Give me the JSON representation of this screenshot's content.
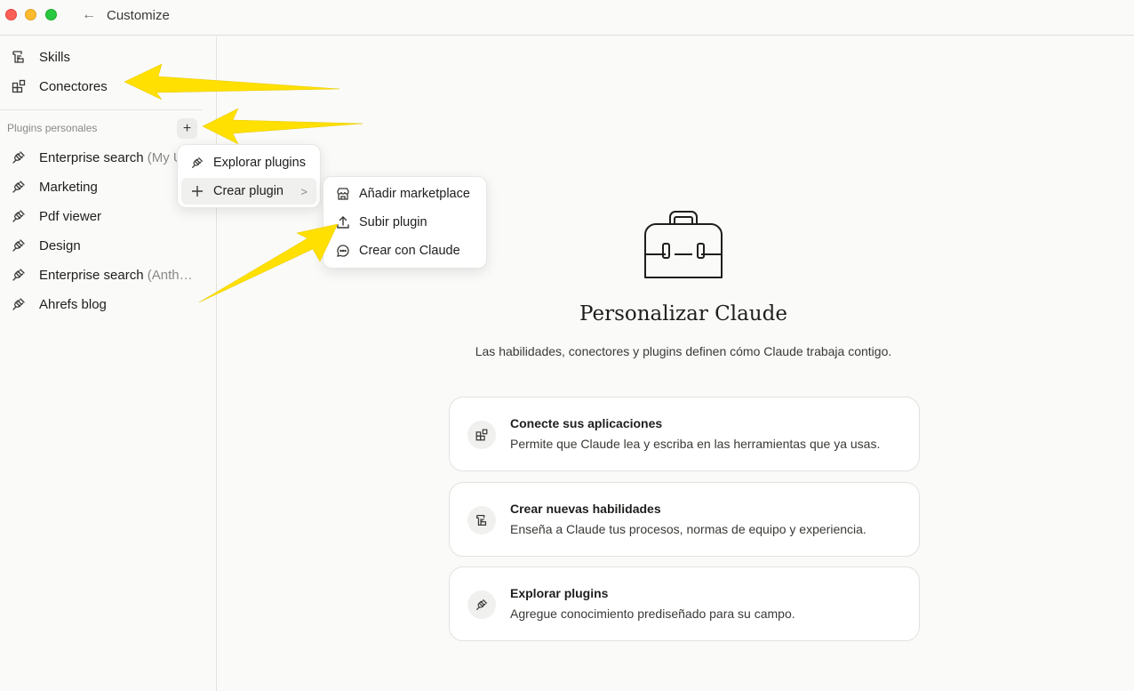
{
  "window": {
    "title": "Customize",
    "back_icon": "arrow-left-icon"
  },
  "sidebar": {
    "nav": [
      {
        "label": "Skills",
        "icon": "skills-icon"
      },
      {
        "label": "Conectores",
        "icon": "connectors-icon"
      }
    ],
    "section_label": "Plugins personales",
    "add_button": "+",
    "plugins": [
      {
        "label": "Enterprise search",
        "suffix": " (My U",
        "icon": "plug-icon"
      },
      {
        "label": "Marketing",
        "suffix": "",
        "icon": "plug-icon"
      },
      {
        "label": "Pdf viewer",
        "suffix": "",
        "icon": "plug-icon"
      },
      {
        "label": "Design",
        "suffix": "",
        "icon": "plug-icon"
      },
      {
        "label": "Enterprise search",
        "suffix": " (Anth…",
        "icon": "plug-icon"
      },
      {
        "label": "Ahrefs blog",
        "suffix": "",
        "icon": "plug-icon"
      }
    ]
  },
  "menu": {
    "items": [
      {
        "label": "Explorar plugins",
        "icon": "plug-icon"
      },
      {
        "label": "Crear plugin",
        "icon": "plus-icon",
        "chevron": ">"
      }
    ]
  },
  "submenu": {
    "items": [
      {
        "label": "Añadir marketplace",
        "icon": "store-icon"
      },
      {
        "label": "Subir plugin",
        "icon": "upload-icon"
      },
      {
        "label": "Crear con Claude",
        "icon": "chat-icon"
      }
    ]
  },
  "main": {
    "hero_icon": "toolbox-icon",
    "title": "Personalizar Claude",
    "subtitle": "Las habilidades, conectores y plugins definen cómo Claude trabaja contigo.",
    "cards": [
      {
        "title": "Conecte sus aplicaciones",
        "desc": "Permite que Claude lea y escriba en las herramientas que ya usas.",
        "icon": "connectors-icon"
      },
      {
        "title": "Crear nuevas habilidades",
        "desc": "Enseña a Claude tus procesos, normas de equipo y experiencia.",
        "icon": "skills-icon"
      },
      {
        "title": "Explorar plugins",
        "desc": "Agregue conocimiento prediseñado para su campo.",
        "icon": "plug-icon"
      }
    ]
  },
  "colors": {
    "annotation_arrow": "#ffe000",
    "accent_dark": "#1f1e1d"
  }
}
